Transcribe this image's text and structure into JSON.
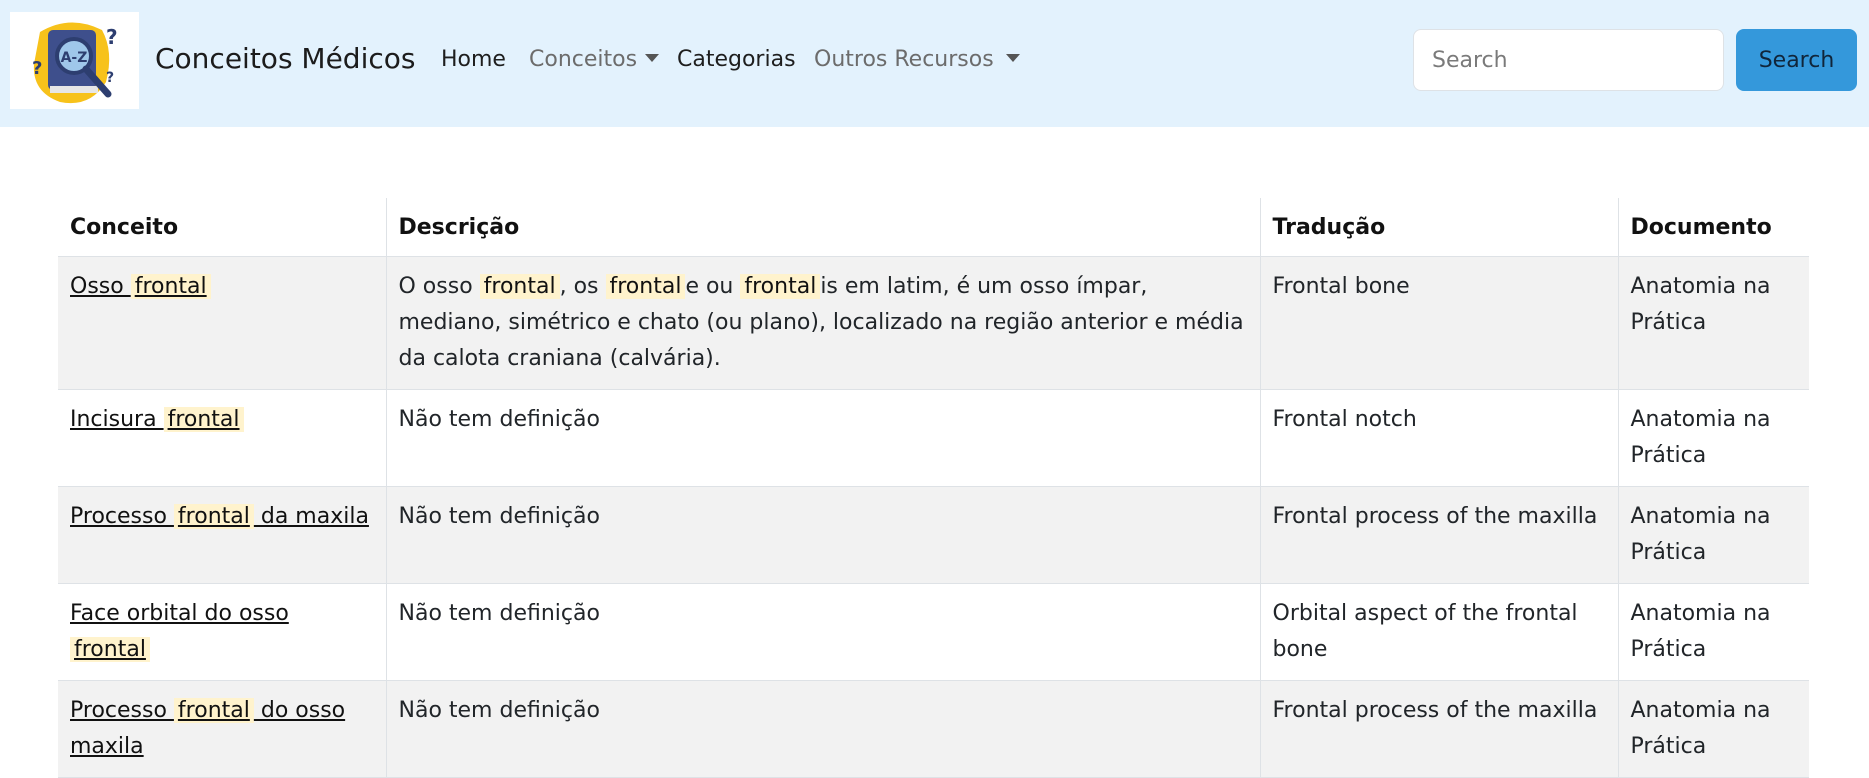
{
  "header": {
    "brand": "Conceitos Médicos",
    "nav": {
      "home": "Home",
      "conceitos": "Conceitos",
      "categorias": "Categorias",
      "outros": "Outros Recursos"
    },
    "search": {
      "placeholder": "Search",
      "button": "Search"
    }
  },
  "table": {
    "headers": [
      "Conceito",
      "Descrição",
      "Tradução",
      "Documento"
    ],
    "highlight_term": "frontal",
    "rows": [
      {
        "concept": [
          "Osso ",
          "frontal",
          ""
        ],
        "description": [
          "O osso ",
          "frontal",
          ", os ",
          "frontal",
          "e ou ",
          "frontal",
          "is em latim, é um osso ímpar, mediano, simétrico e chato (ou plano), localizado na região anterior e média da calota craniana (calvária)."
        ],
        "translation": "Frontal bone",
        "document": "Anatomia na Prática"
      },
      {
        "concept": [
          "Incisura ",
          "frontal",
          ""
        ],
        "description": [
          "Não tem definição"
        ],
        "translation": "Frontal notch",
        "document": "Anatomia na Prática"
      },
      {
        "concept": [
          "Processo ",
          "frontal",
          " da maxila"
        ],
        "description": [
          "Não tem definição"
        ],
        "translation": "Frontal process of the maxilla",
        "document": "Anatomia na Prática"
      },
      {
        "concept": [
          "Face orbital do osso ",
          "frontal",
          ""
        ],
        "description": [
          "Não tem definição"
        ],
        "translation": "Orbital aspect of the frontal bone",
        "document": "Anatomia na Prática"
      },
      {
        "concept": [
          "Processo ",
          "frontal",
          " do osso maxila"
        ],
        "description": [
          "Não tem definição"
        ],
        "translation": "Frontal process of the maxilla",
        "document": "Anatomia na Prática"
      }
    ]
  },
  "colors": {
    "navbar_bg": "#e3f2fd",
    "search_button": "#3498db",
    "highlight": "#fff3cd",
    "striped_row": "#f2f2f2"
  },
  "icons": {
    "logo": "medical-dictionary-logo"
  }
}
